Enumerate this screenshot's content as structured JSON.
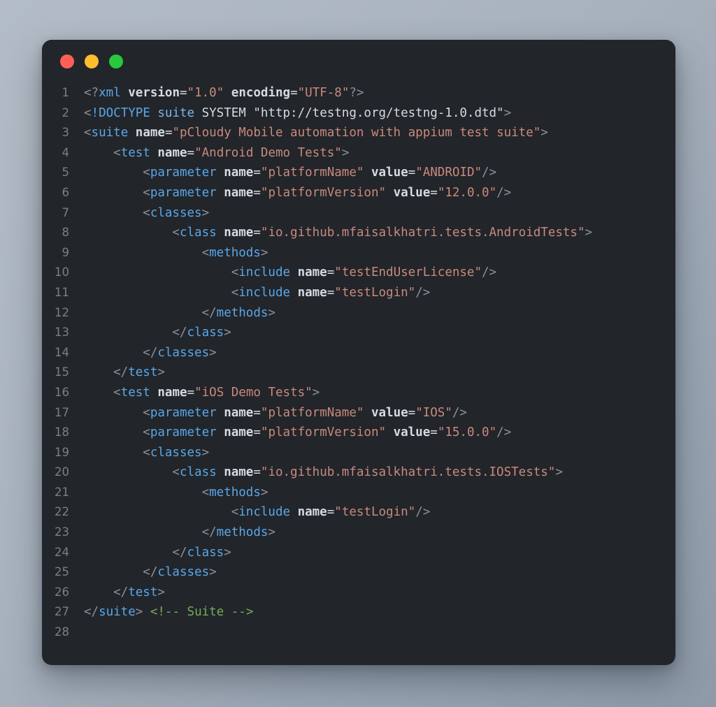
{
  "window": {
    "titlebar": {
      "close_label": "close",
      "minimize_label": "minimize",
      "maximize_label": "maximize"
    }
  },
  "colors": {
    "background_dark": "#22252a",
    "traffic_red": "#ff5f56",
    "traffic_yellow": "#ffbd2e",
    "traffic_green": "#27c93f",
    "line_number": "#7c8085",
    "punct": "#8b9199",
    "tag": "#5aa7e8",
    "attribute": "#d5dbe3",
    "string": "#c98a7d",
    "comment": "#73ad5a",
    "plain_text": "#d5dbe3"
  },
  "editor": {
    "language": "xml",
    "total_lines": 28,
    "lines": [
      {
        "number": "1",
        "tokens": [
          {
            "t": "<?",
            "c": "t-punct"
          },
          {
            "t": "xml",
            "c": "t-tag"
          },
          {
            "t": " ",
            "c": "t-plain"
          },
          {
            "t": "version",
            "c": "t-attr"
          },
          {
            "t": "=",
            "c": "t-eq"
          },
          {
            "t": "\"1.0\"",
            "c": "t-string"
          },
          {
            "t": " ",
            "c": "t-plain"
          },
          {
            "t": "encoding",
            "c": "t-attr"
          },
          {
            "t": "=",
            "c": "t-eq"
          },
          {
            "t": "\"UTF-8\"",
            "c": "t-string"
          },
          {
            "t": "?>",
            "c": "t-punct"
          }
        ]
      },
      {
        "number": "2",
        "tokens": [
          {
            "t": "<",
            "c": "t-punct"
          },
          {
            "t": "!DOCTYPE",
            "c": "t-doctype"
          },
          {
            "t": " ",
            "c": "t-plain"
          },
          {
            "t": "suite",
            "c": "t-dname"
          },
          {
            "t": " SYSTEM \"http://testng.org/testng-1.0.dtd\"",
            "c": "t-plain"
          },
          {
            "t": ">",
            "c": "t-punct"
          }
        ]
      },
      {
        "number": "3",
        "tokens": [
          {
            "t": "<",
            "c": "t-punct"
          },
          {
            "t": "suite",
            "c": "t-tag"
          },
          {
            "t": " ",
            "c": "t-plain"
          },
          {
            "t": "name",
            "c": "t-attr"
          },
          {
            "t": "=",
            "c": "t-eq"
          },
          {
            "t": "\"pCloudy Mobile automation with appium test suite\"",
            "c": "t-string"
          },
          {
            "t": ">",
            "c": "t-punct"
          }
        ]
      },
      {
        "number": "4",
        "tokens": [
          {
            "t": "    <",
            "c": "t-punct"
          },
          {
            "t": "test",
            "c": "t-tag"
          },
          {
            "t": " ",
            "c": "t-plain"
          },
          {
            "t": "name",
            "c": "t-attr"
          },
          {
            "t": "=",
            "c": "t-eq"
          },
          {
            "t": "\"Android Demo Tests\"",
            "c": "t-string"
          },
          {
            "t": ">",
            "c": "t-punct"
          }
        ]
      },
      {
        "number": "5",
        "tokens": [
          {
            "t": "        <",
            "c": "t-punct"
          },
          {
            "t": "parameter",
            "c": "t-tag"
          },
          {
            "t": " ",
            "c": "t-plain"
          },
          {
            "t": "name",
            "c": "t-attr"
          },
          {
            "t": "=",
            "c": "t-eq"
          },
          {
            "t": "\"platformName\"",
            "c": "t-string"
          },
          {
            "t": " ",
            "c": "t-plain"
          },
          {
            "t": "value",
            "c": "t-attr"
          },
          {
            "t": "=",
            "c": "t-eq"
          },
          {
            "t": "\"ANDROID\"",
            "c": "t-string"
          },
          {
            "t": "/>",
            "c": "t-punct"
          }
        ]
      },
      {
        "number": "6",
        "tokens": [
          {
            "t": "        <",
            "c": "t-punct"
          },
          {
            "t": "parameter",
            "c": "t-tag"
          },
          {
            "t": " ",
            "c": "t-plain"
          },
          {
            "t": "name",
            "c": "t-attr"
          },
          {
            "t": "=",
            "c": "t-eq"
          },
          {
            "t": "\"platformVersion\"",
            "c": "t-string"
          },
          {
            "t": " ",
            "c": "t-plain"
          },
          {
            "t": "value",
            "c": "t-attr"
          },
          {
            "t": "=",
            "c": "t-eq"
          },
          {
            "t": "\"12.0.0\"",
            "c": "t-string"
          },
          {
            "t": "/>",
            "c": "t-punct"
          }
        ]
      },
      {
        "number": "7",
        "tokens": [
          {
            "t": "        <",
            "c": "t-punct"
          },
          {
            "t": "classes",
            "c": "t-tag"
          },
          {
            "t": ">",
            "c": "t-punct"
          }
        ]
      },
      {
        "number": "8",
        "tokens": [
          {
            "t": "            <",
            "c": "t-punct"
          },
          {
            "t": "class",
            "c": "t-tag"
          },
          {
            "t": " ",
            "c": "t-plain"
          },
          {
            "t": "name",
            "c": "t-attr"
          },
          {
            "t": "=",
            "c": "t-eq"
          },
          {
            "t": "\"io.github.mfaisalkhatri.tests.AndroidTests\"",
            "c": "t-string"
          },
          {
            "t": ">",
            "c": "t-punct"
          }
        ]
      },
      {
        "number": "9",
        "tokens": [
          {
            "t": "                <",
            "c": "t-punct"
          },
          {
            "t": "methods",
            "c": "t-tag"
          },
          {
            "t": ">",
            "c": "t-punct"
          }
        ]
      },
      {
        "number": "10",
        "tokens": [
          {
            "t": "                    <",
            "c": "t-punct"
          },
          {
            "t": "include",
            "c": "t-tag"
          },
          {
            "t": " ",
            "c": "t-plain"
          },
          {
            "t": "name",
            "c": "t-attr"
          },
          {
            "t": "=",
            "c": "t-eq"
          },
          {
            "t": "\"testEndUserLicense\"",
            "c": "t-string"
          },
          {
            "t": "/>",
            "c": "t-punct"
          }
        ]
      },
      {
        "number": "11",
        "tokens": [
          {
            "t": "                    <",
            "c": "t-punct"
          },
          {
            "t": "include",
            "c": "t-tag"
          },
          {
            "t": " ",
            "c": "t-plain"
          },
          {
            "t": "name",
            "c": "t-attr"
          },
          {
            "t": "=",
            "c": "t-eq"
          },
          {
            "t": "\"testLogin\"",
            "c": "t-string"
          },
          {
            "t": "/>",
            "c": "t-punct"
          }
        ]
      },
      {
        "number": "12",
        "tokens": [
          {
            "t": "                </",
            "c": "t-punct"
          },
          {
            "t": "methods",
            "c": "t-tag"
          },
          {
            "t": ">",
            "c": "t-punct"
          }
        ]
      },
      {
        "number": "13",
        "tokens": [
          {
            "t": "            </",
            "c": "t-punct"
          },
          {
            "t": "class",
            "c": "t-tag"
          },
          {
            "t": ">",
            "c": "t-punct"
          }
        ]
      },
      {
        "number": "14",
        "tokens": [
          {
            "t": "        </",
            "c": "t-punct"
          },
          {
            "t": "classes",
            "c": "t-tag"
          },
          {
            "t": ">",
            "c": "t-punct"
          }
        ]
      },
      {
        "number": "15",
        "tokens": [
          {
            "t": "    </",
            "c": "t-punct"
          },
          {
            "t": "test",
            "c": "t-tag"
          },
          {
            "t": ">",
            "c": "t-punct"
          }
        ]
      },
      {
        "number": "16",
        "tokens": [
          {
            "t": "    <",
            "c": "t-punct"
          },
          {
            "t": "test",
            "c": "t-tag"
          },
          {
            "t": " ",
            "c": "t-plain"
          },
          {
            "t": "name",
            "c": "t-attr"
          },
          {
            "t": "=",
            "c": "t-eq"
          },
          {
            "t": "\"iOS Demo Tests\"",
            "c": "t-string"
          },
          {
            "t": ">",
            "c": "t-punct"
          }
        ]
      },
      {
        "number": "17",
        "tokens": [
          {
            "t": "        <",
            "c": "t-punct"
          },
          {
            "t": "parameter",
            "c": "t-tag"
          },
          {
            "t": " ",
            "c": "t-plain"
          },
          {
            "t": "name",
            "c": "t-attr"
          },
          {
            "t": "=",
            "c": "t-eq"
          },
          {
            "t": "\"platformName\"",
            "c": "t-string"
          },
          {
            "t": " ",
            "c": "t-plain"
          },
          {
            "t": "value",
            "c": "t-attr"
          },
          {
            "t": "=",
            "c": "t-eq"
          },
          {
            "t": "\"IOS\"",
            "c": "t-string"
          },
          {
            "t": "/>",
            "c": "t-punct"
          }
        ]
      },
      {
        "number": "18",
        "tokens": [
          {
            "t": "        <",
            "c": "t-punct"
          },
          {
            "t": "parameter",
            "c": "t-tag"
          },
          {
            "t": " ",
            "c": "t-plain"
          },
          {
            "t": "name",
            "c": "t-attr"
          },
          {
            "t": "=",
            "c": "t-eq"
          },
          {
            "t": "\"platformVersion\"",
            "c": "t-string"
          },
          {
            "t": " ",
            "c": "t-plain"
          },
          {
            "t": "value",
            "c": "t-attr"
          },
          {
            "t": "=",
            "c": "t-eq"
          },
          {
            "t": "\"15.0.0\"",
            "c": "t-string"
          },
          {
            "t": "/>",
            "c": "t-punct"
          }
        ]
      },
      {
        "number": "19",
        "tokens": [
          {
            "t": "        <",
            "c": "t-punct"
          },
          {
            "t": "classes",
            "c": "t-tag"
          },
          {
            "t": ">",
            "c": "t-punct"
          }
        ]
      },
      {
        "number": "20",
        "tokens": [
          {
            "t": "            <",
            "c": "t-punct"
          },
          {
            "t": "class",
            "c": "t-tag"
          },
          {
            "t": " ",
            "c": "t-plain"
          },
          {
            "t": "name",
            "c": "t-attr"
          },
          {
            "t": "=",
            "c": "t-eq"
          },
          {
            "t": "\"io.github.mfaisalkhatri.tests.IOSTests\"",
            "c": "t-string"
          },
          {
            "t": ">",
            "c": "t-punct"
          }
        ]
      },
      {
        "number": "21",
        "tokens": [
          {
            "t": "                <",
            "c": "t-punct"
          },
          {
            "t": "methods",
            "c": "t-tag"
          },
          {
            "t": ">",
            "c": "t-punct"
          }
        ]
      },
      {
        "number": "22",
        "tokens": [
          {
            "t": "                    <",
            "c": "t-punct"
          },
          {
            "t": "include",
            "c": "t-tag"
          },
          {
            "t": " ",
            "c": "t-plain"
          },
          {
            "t": "name",
            "c": "t-attr"
          },
          {
            "t": "=",
            "c": "t-eq"
          },
          {
            "t": "\"testLogin\"",
            "c": "t-string"
          },
          {
            "t": "/>",
            "c": "t-punct"
          }
        ]
      },
      {
        "number": "23",
        "tokens": [
          {
            "t": "                </",
            "c": "t-punct"
          },
          {
            "t": "methods",
            "c": "t-tag"
          },
          {
            "t": ">",
            "c": "t-punct"
          }
        ]
      },
      {
        "number": "24",
        "tokens": [
          {
            "t": "            </",
            "c": "t-punct"
          },
          {
            "t": "class",
            "c": "t-tag"
          },
          {
            "t": ">",
            "c": "t-punct"
          }
        ]
      },
      {
        "number": "25",
        "tokens": [
          {
            "t": "        </",
            "c": "t-punct"
          },
          {
            "t": "classes",
            "c": "t-tag"
          },
          {
            "t": ">",
            "c": "t-punct"
          }
        ]
      },
      {
        "number": "26",
        "tokens": [
          {
            "t": "    </",
            "c": "t-punct"
          },
          {
            "t": "test",
            "c": "t-tag"
          },
          {
            "t": ">",
            "c": "t-punct"
          }
        ]
      },
      {
        "number": "27",
        "tokens": [
          {
            "t": "</",
            "c": "t-punct"
          },
          {
            "t": "suite",
            "c": "t-tag"
          },
          {
            "t": ">",
            "c": "t-punct"
          },
          {
            "t": " ",
            "c": "t-plain"
          },
          {
            "t": "<!-- Suite -->",
            "c": "t-comment"
          }
        ]
      },
      {
        "number": "28",
        "tokens": []
      }
    ]
  }
}
